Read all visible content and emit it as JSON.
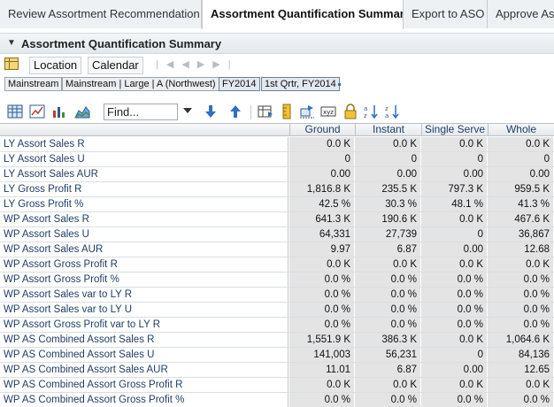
{
  "tabs": [
    {
      "label": "Review Assortment Recommendation",
      "active": false
    },
    {
      "label": "Assortment Quantification Summary",
      "active": true
    },
    {
      "label": "Export to ASO",
      "active": false
    },
    {
      "label": "Approve Ass",
      "active": false
    }
  ],
  "panel": {
    "title": "Assortment Quantification Summary"
  },
  "dimensions": {
    "location_label": "Location",
    "calendar_label": "Calendar"
  },
  "breadcrumbs": [
    {
      "label": "Mainstream"
    },
    {
      "label": "Mainstream | Large | A (Northwest)"
    },
    {
      "label": "FY2014"
    },
    {
      "label": "1st Qrtr, FY2014"
    }
  ],
  "toolbar": {
    "find_placeholder": "Find..."
  },
  "grid": {
    "columns": [
      "Ground",
      "Instant",
      "Single Serve",
      "Whole"
    ],
    "rows": [
      {
        "label": "LY Assort Sales R",
        "values": [
          "0.0 K",
          "0.0 K",
          "0.0 K",
          "0.0 K"
        ]
      },
      {
        "label": "LY Assort Sales U",
        "values": [
          "0",
          "0",
          "0",
          "0"
        ]
      },
      {
        "label": "LY Assort Sales AUR",
        "values": [
          "0.00",
          "0.00",
          "0.00",
          "0.00"
        ]
      },
      {
        "label": "LY Gross Profit R",
        "values": [
          "1,816.8 K",
          "235.5 K",
          "797.3 K",
          "959.5 K"
        ]
      },
      {
        "label": "LY Gross Profit %",
        "values": [
          "42.5 %",
          "30.3 %",
          "48.1 %",
          "41.3 %"
        ]
      },
      {
        "label": "WP Assort Sales R",
        "values": [
          "641.3 K",
          "190.6 K",
          "0.0 K",
          "467.6 K"
        ]
      },
      {
        "label": "WP Assort Sales U",
        "values": [
          "64,331",
          "27,739",
          "0",
          "36,867"
        ]
      },
      {
        "label": "WP Assort Sales AUR",
        "values": [
          "9.97",
          "6.87",
          "0.00",
          "12.68"
        ]
      },
      {
        "label": "WP Assort Gross Profit R",
        "values": [
          "0.0 K",
          "0.0 K",
          "0.0 K",
          "0.0 K"
        ]
      },
      {
        "label": "WP Assort Gross Profit %",
        "values": [
          "0.0 %",
          "0.0 %",
          "0.0 %",
          "0.0 %"
        ]
      },
      {
        "label": "WP Assort Sales var to LY R",
        "values": [
          "0.0 %",
          "0.0 %",
          "0.0 %",
          "0.0 %"
        ]
      },
      {
        "label": "WP Assort Sales var to LY U",
        "values": [
          "0.0 %",
          "0.0 %",
          "0.0 %",
          "0.0 %"
        ]
      },
      {
        "label": "WP Assort Gross Profit var to LY R",
        "values": [
          "0.0 %",
          "0.0 %",
          "0.0 %",
          "0.0 %"
        ]
      },
      {
        "label": "WP AS Combined Assort Sales R",
        "values": [
          "1,551.9 K",
          "386.3 K",
          "0.0 K",
          "1,064.6 K"
        ]
      },
      {
        "label": "WP AS Combined Assort Sales U",
        "values": [
          "141,003",
          "56,231",
          "0",
          "84,136"
        ]
      },
      {
        "label": "WP AS Combined Assort Sales AUR",
        "values": [
          "11.01",
          "6.87",
          "0.00",
          "12.65"
        ]
      },
      {
        "label": "WP AS Combined Assort Gross Profit R",
        "values": [
          "0.0 K",
          "0.0 K",
          "0.0 K",
          "0.0 K"
        ]
      },
      {
        "label": "WP AS Combined Assort Gross Profit %",
        "values": [
          "0.0 %",
          "0.0 %",
          "0.0 %",
          "0.0 %"
        ]
      }
    ]
  },
  "colors": {
    "header_text": "#1f3f66",
    "cell_bg": "#e4e4e4",
    "accent": "#2f6fc4"
  }
}
